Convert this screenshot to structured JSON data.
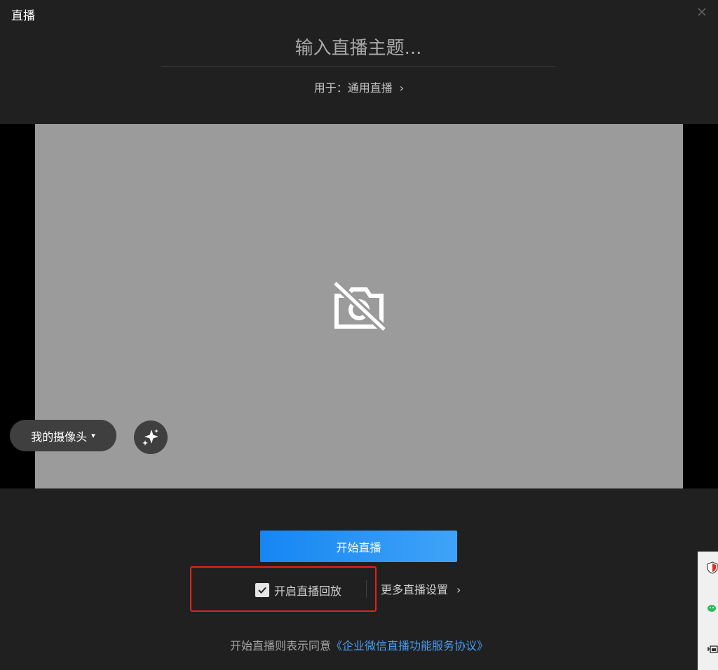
{
  "window": {
    "title": "直播"
  },
  "topic": {
    "placeholder": "输入直播主题..."
  },
  "usage": {
    "label": "用于：通用直播",
    "chevron": "›"
  },
  "camera": {
    "status_icon": "camera-off-icon",
    "selector_label": "我的摄像头",
    "caret": "▾",
    "beauty_icon": "sparkle-icon"
  },
  "actions": {
    "start_label": "开始直播",
    "replay_label": "开启直播回放",
    "replay_checked": true,
    "more_settings_label": "更多直播设置",
    "more_chevron": "›"
  },
  "agreement": {
    "prefix": "开始直播则表示同意",
    "link": "《企业微信直播功能服务协议》"
  },
  "colors": {
    "background": "#202020",
    "preview": "#9b9b9b",
    "primary": "#1686f3",
    "link": "#4a9cf2",
    "highlight": "#e5221b"
  }
}
